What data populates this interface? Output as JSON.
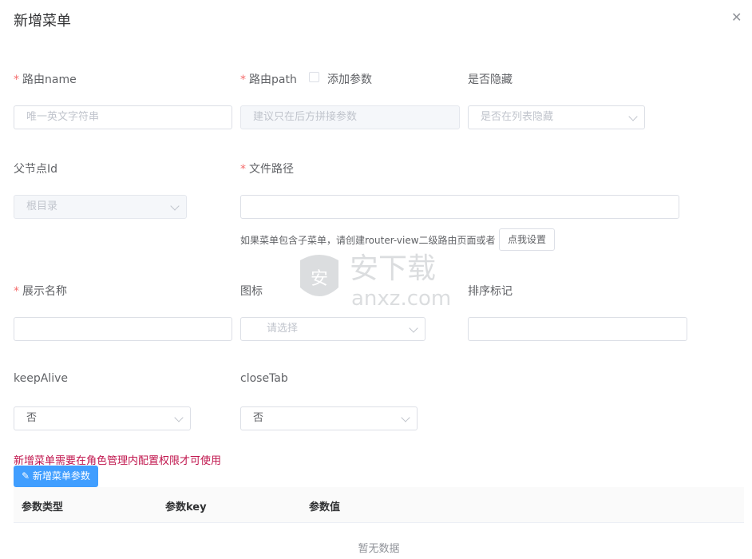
{
  "dialog": {
    "title": "新增菜单",
    "close_icon": "close-icon"
  },
  "form": {
    "route_name": {
      "label": "路由name",
      "placeholder": "唯一英文字符串"
    },
    "route_path": {
      "label": "路由path",
      "add_param_label": "添加参数",
      "placeholder": "建议只在后方拼接参数"
    },
    "hidden": {
      "label": "是否隐藏",
      "placeholder": "是否在列表隐藏"
    },
    "parent_id": {
      "label": "父节点Id",
      "value": "根目录"
    },
    "file_path": {
      "label": "文件路径",
      "value": ""
    },
    "submenu_hint": {
      "text": "如果菜单包含子菜单，请创建router-view二级路由页面或者",
      "button": "点我设置"
    },
    "display_name": {
      "label": "展示名称",
      "value": ""
    },
    "icon": {
      "label": "图标",
      "placeholder": "请选择"
    },
    "sort": {
      "label": "排序标记",
      "value": ""
    },
    "keep_alive": {
      "label": "keepAlive",
      "value": "否"
    },
    "close_tab": {
      "label": "closeTab",
      "value": "否"
    }
  },
  "notice": "新增菜单需要在角色管理内配置权限才可使用",
  "params": {
    "add_button": "新增菜单参数",
    "columns": [
      "参数类型",
      "参数key",
      "参数值"
    ],
    "empty_text": "暂无数据"
  },
  "watermark": {
    "brand": "安下载",
    "domain": "anxz.com"
  }
}
